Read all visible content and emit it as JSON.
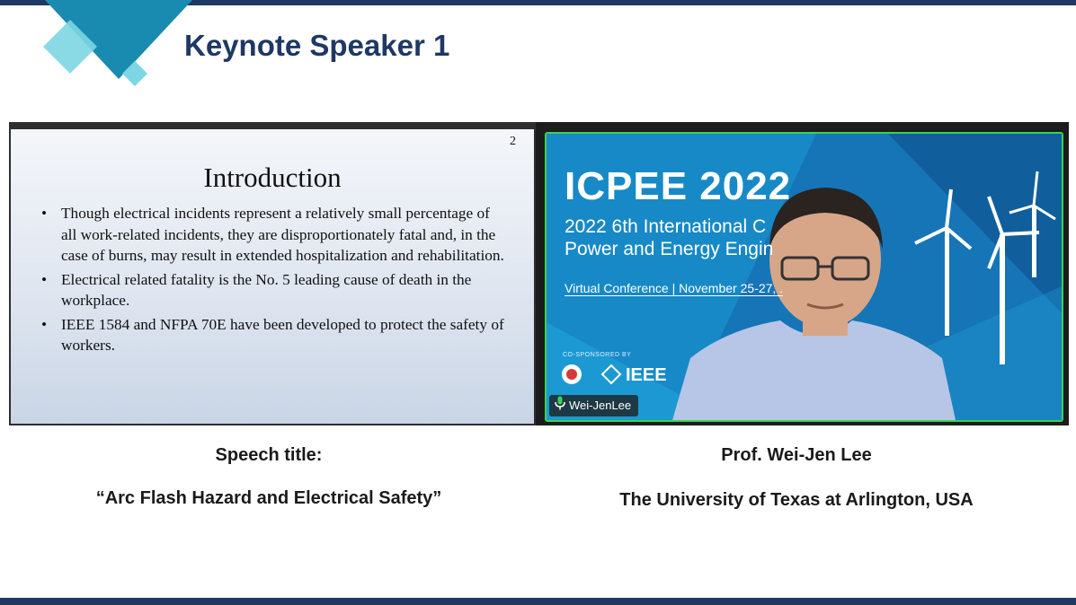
{
  "header": {
    "title": "Keynote Speaker 1"
  },
  "slide": {
    "page_number": "2",
    "title": "Introduction",
    "bullets": [
      "Though electrical incidents represent a relatively small percentage of all work-related incidents, they are disproportionately fatal and, in the case of burns, may result in extended hospitalization and rehabilitation.",
      "Electrical related fatality is the No. 5 leading cause of death in the workplace.",
      "IEEE 1584 and NFPA 70E have been developed to protect the safety of workers."
    ]
  },
  "video": {
    "background_title": "ICPEE 2022",
    "background_line1": "2022 6th International C",
    "background_line2": "Power and Energy Engin",
    "background_virtual": "Virtual Conference | November 25-27, .",
    "cosponsor_label": "CO-SPONSORED BY",
    "ieee_logo_text": "IEEE",
    "participant_name": "Wei-JenLee",
    "active_speaker_color": "#39d353"
  },
  "captions": {
    "speech_label": "Speech title:",
    "speech_title": "“Arc Flash Hazard and Electrical Safety”",
    "speaker_name": "Prof. Wei-Jen Lee",
    "speaker_affiliation": "The University of Texas at Arlington, USA"
  },
  "colors": {
    "brand_navy": "#1f3864",
    "accent_teal": "#1a8bb0",
    "accent_light": "#6fd0e0"
  }
}
